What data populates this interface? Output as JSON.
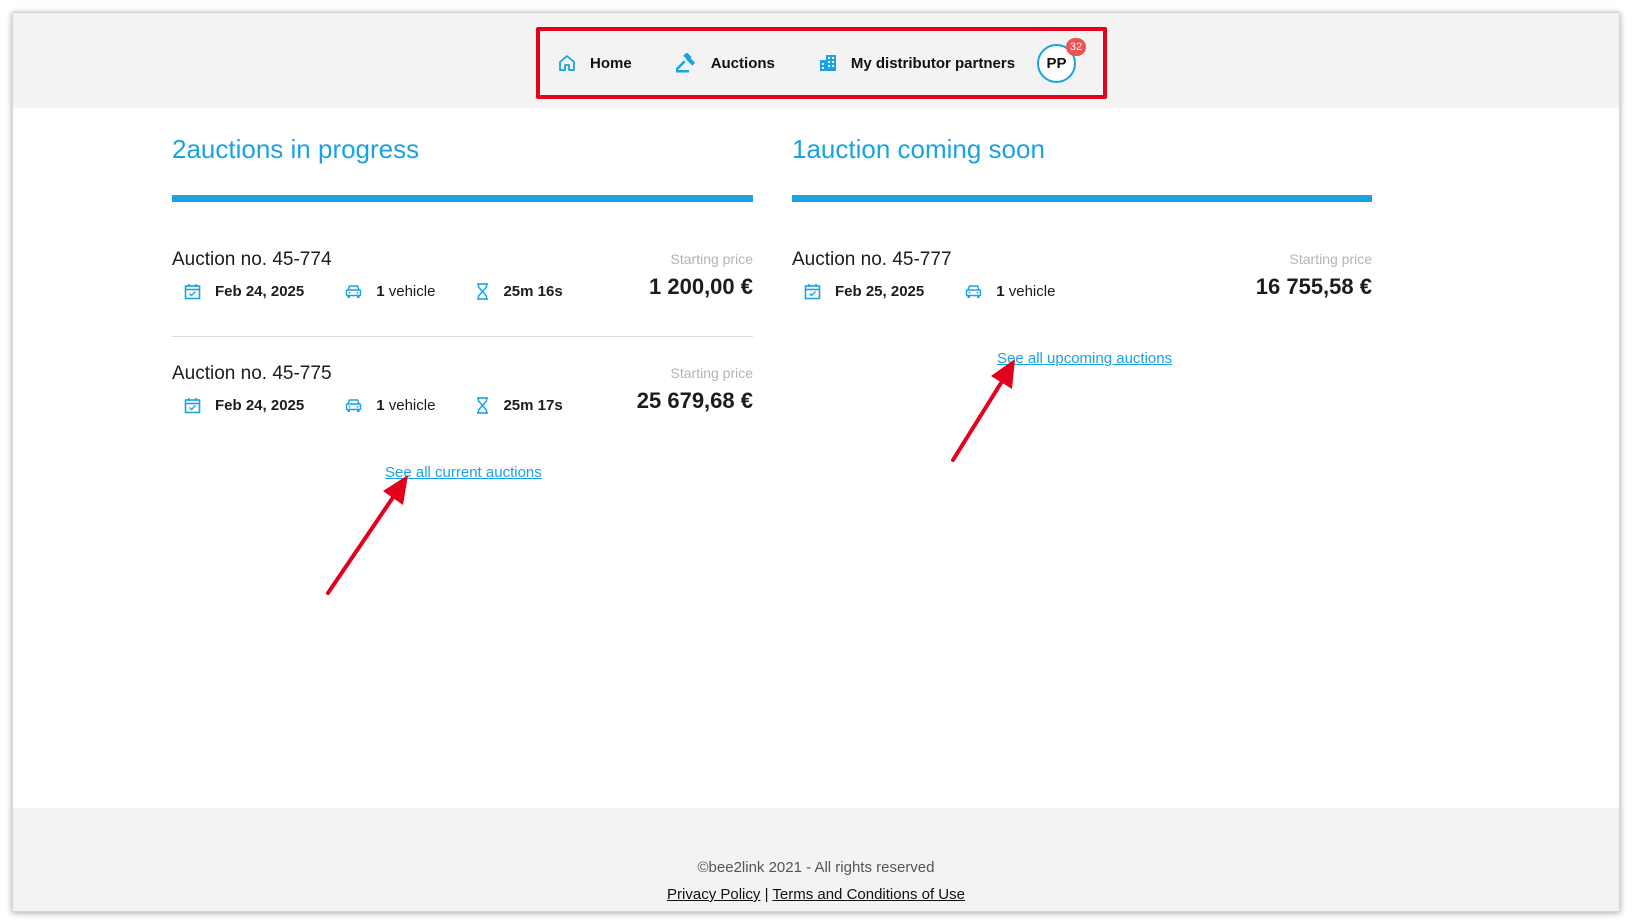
{
  "nav": {
    "items": [
      {
        "label": "Home",
        "icon": "home-icon"
      },
      {
        "label": "Auctions",
        "icon": "gavel-icon"
      },
      {
        "label": "My distributor partners",
        "icon": "building-icon"
      }
    ],
    "avatar_initials": "PP",
    "notification_count": "32"
  },
  "in_progress": {
    "title": "2auctions in progress",
    "auctions": [
      {
        "name": "Auction no. 45-774",
        "date": "Feb 24, 2025",
        "vehicle_count": "1",
        "vehicle_word": "vehicle",
        "time_left": "25m 16s",
        "price_label": "Starting price",
        "price": "1 200,00 €"
      },
      {
        "name": "Auction no. 45-775",
        "date": "Feb 24, 2025",
        "vehicle_count": "1",
        "vehicle_word": "vehicle",
        "time_left": "25m 17s",
        "price_label": "Starting price",
        "price": "25 679,68 €"
      }
    ],
    "see_all": "See all current auctions"
  },
  "coming_soon": {
    "title": "1auction coming soon",
    "auctions": [
      {
        "name": "Auction no. 45-777",
        "date": "Feb 25, 2025",
        "vehicle_count": "1",
        "vehicle_word": "vehicle",
        "price_label": "Starting price",
        "price": "16 755,58 €"
      }
    ],
    "see_all": "See all upcoming auctions"
  },
  "footer": {
    "copyright": "©bee2link 2021 - All rights reserved",
    "privacy": "Privacy Policy",
    "separator": "|",
    "terms": "Terms and Conditions of Use"
  },
  "colors": {
    "accent": "#1aa3e0",
    "annotation": "#e3001b",
    "badge": "#ef5350"
  }
}
